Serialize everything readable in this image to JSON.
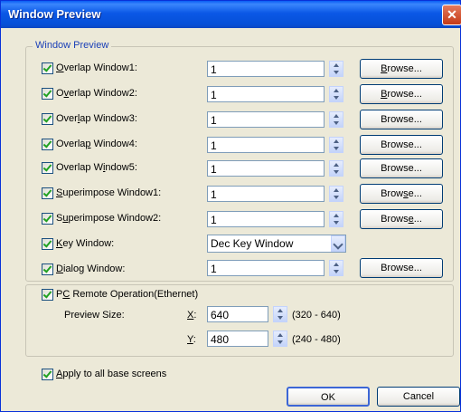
{
  "window": {
    "title": "Window Preview",
    "close_symbol": "✕"
  },
  "group": {
    "label": "Window Preview"
  },
  "rows": [
    {
      "pre": "",
      "u": "O",
      "post": "verlap Window1:",
      "value": "1",
      "browse_pre": "",
      "browse_u": "B",
      "browse_post": "rowse..."
    },
    {
      "pre": "O",
      "u": "v",
      "post": "erlap Window2:",
      "value": "1",
      "browse_pre": "",
      "browse_u": "B",
      "browse_post": "rowse..."
    },
    {
      "pre": "Over",
      "u": "l",
      "post": "ap Window3:",
      "value": "1",
      "browse_pre": "Browse...",
      "browse_u": "",
      "browse_post": ""
    },
    {
      "pre": "Overla",
      "u": "p",
      "post": " Window4:",
      "value": "1",
      "browse_pre": "Browse...",
      "browse_u": "",
      "browse_post": ""
    },
    {
      "pre": "Overlap W",
      "u": "i",
      "post": "ndow5:",
      "value": "1",
      "browse_pre": "Browse...",
      "browse_u": "",
      "browse_post": ""
    },
    {
      "pre": "",
      "u": "S",
      "post": "uperimpose Window1:",
      "value": "1",
      "browse_pre": "Brow",
      "browse_u": "s",
      "browse_post": "e..."
    },
    {
      "pre": "S",
      "u": "u",
      "post": "perimpose Window2:",
      "value": "1",
      "browse_pre": "Brows",
      "browse_u": "e",
      "browse_post": "..."
    }
  ],
  "key_window": {
    "pre": "",
    "u": "K",
    "post": "ey Window:",
    "value": "Dec Key Window"
  },
  "dialog_window": {
    "pre": "",
    "u": "D",
    "post": "ialog Window:",
    "value": "1",
    "browse": "Browse..."
  },
  "pc_remote": {
    "pre": "P",
    "u": "C",
    "post": " Remote Operation(Ethernet)"
  },
  "preview_size": {
    "label": "Preview Size:",
    "x_u": "X",
    "x_colon": ":",
    "x_value": "640",
    "x_range": "(320 - 640)",
    "y_u": "Y",
    "y_colon": ":",
    "y_value": "480",
    "y_range": "(240 - 480)"
  },
  "apply_all": {
    "pre": "",
    "u": "A",
    "post": "pply to all base screens"
  },
  "buttons": {
    "ok": "OK",
    "cancel": "Cancel"
  }
}
